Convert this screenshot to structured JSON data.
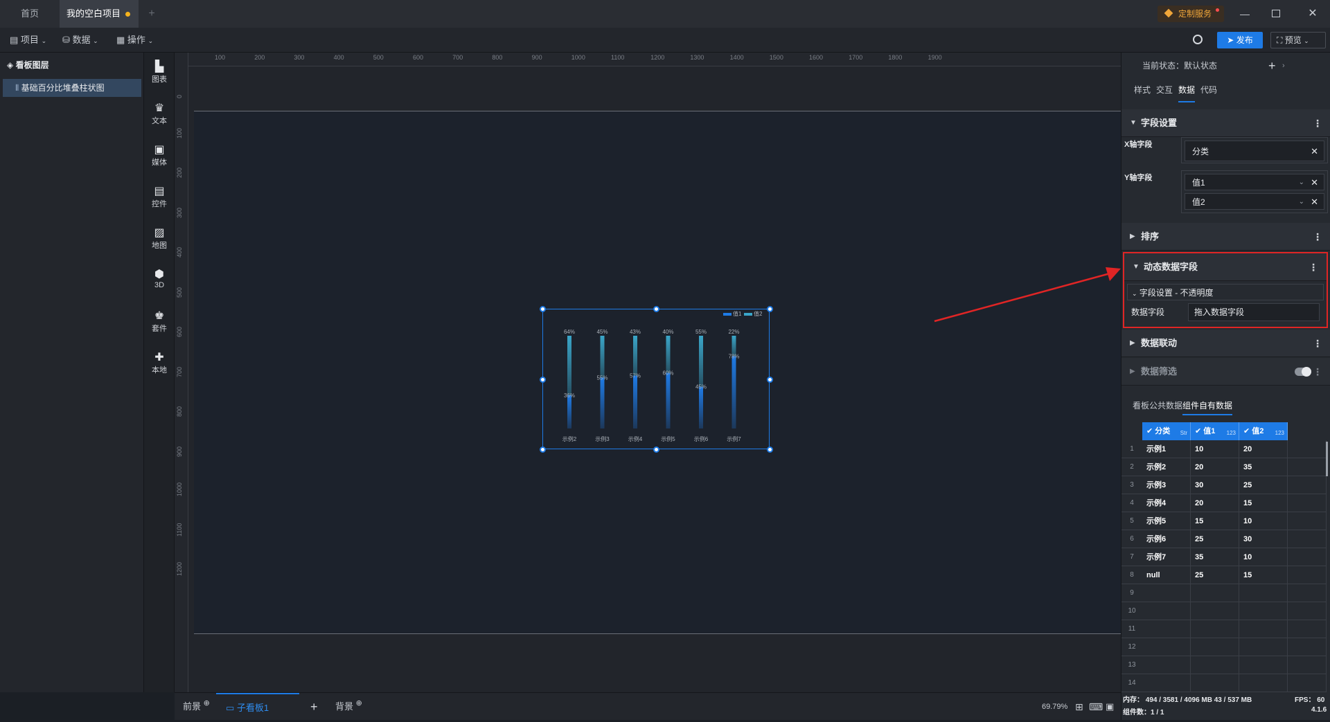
{
  "titlebar": {
    "tabs": [
      {
        "label": "首页",
        "active": false
      },
      {
        "label": "我的空白项目",
        "active": true,
        "modified": true
      }
    ],
    "add_tab": "+",
    "custom_service": "定制服务",
    "window_controls": [
      "minimize-icon",
      "restore-icon",
      "close-icon"
    ]
  },
  "toolbar": {
    "menus": [
      {
        "label": "项目",
        "icon": "file-icon"
      },
      {
        "label": "数据",
        "icon": "database-icon"
      },
      {
        "label": "操作",
        "icon": "grid-icon"
      }
    ],
    "publish": "发布",
    "preview": "预览"
  },
  "layers": {
    "title": "看板图层",
    "items": [
      {
        "label": "基础百分比堆叠柱状图",
        "selected": true
      }
    ]
  },
  "iconbar": {
    "items": [
      {
        "label": "图表",
        "icon": "chart-icon"
      },
      {
        "label": "文本",
        "icon": "text-icon"
      },
      {
        "label": "媒体",
        "icon": "media-icon"
      },
      {
        "label": "控件",
        "icon": "control-icon"
      },
      {
        "label": "地图",
        "icon": "map-icon"
      },
      {
        "label": "3D",
        "icon": "cube-icon"
      },
      {
        "label": "套件",
        "icon": "shirt-icon"
      },
      {
        "label": "本地",
        "icon": "puzzle-icon"
      }
    ]
  },
  "ruler": {
    "h_labels": [
      "100",
      "200",
      "300",
      "400",
      "500",
      "600",
      "700",
      "800",
      "900",
      "1000",
      "1100",
      "1200",
      "1300",
      "1400",
      "1500",
      "1600",
      "1700",
      "1800",
      "1900"
    ],
    "v_labels": [
      "0",
      "100",
      "200",
      "300",
      "400",
      "500",
      "600",
      "700",
      "800",
      "900",
      "1000",
      "1100",
      "1200"
    ]
  },
  "chart_data": {
    "type": "bar",
    "categories": [
      "示例2",
      "示例3",
      "示例4",
      "示例5",
      "示例6",
      "示例7"
    ],
    "series": [
      {
        "name": "值1",
        "values": [
          36,
          55,
          57,
          60,
          45,
          78
        ]
      },
      {
        "name": "值2",
        "values": [
          64,
          45,
          43,
          40,
          55,
          22
        ]
      }
    ],
    "stacked_percent": true,
    "legend": "top-right",
    "colors": {
      "s1": "#1e7be6",
      "s2": "#3aa6c9"
    }
  },
  "bottombar": {
    "tabs": [
      {
        "label": "前景",
        "active": false
      },
      {
        "label": "子看板1",
        "active": true
      },
      {
        "label": "背景",
        "active": false
      }
    ],
    "zoom": "69.79%"
  },
  "rpanel": {
    "state_label": "当前状态：默认状态",
    "tabs": [
      "样式",
      "交互",
      "数据",
      "代码"
    ],
    "active_tab": "数据",
    "field_settings": {
      "title": "字段设置",
      "x_label": "X轴字段",
      "x_value": "分类",
      "y_label": "Y轴字段",
      "y_values": [
        "值1",
        "值2"
      ]
    },
    "sort": "排序",
    "dynamic": {
      "title": "动态数据字段",
      "sub": "字段设置 - 不透明度",
      "field_label": "数据字段",
      "field_placeholder": "拖入数据字段"
    },
    "linkage": "数据联动",
    "filter": "数据筛选",
    "data_tabs": [
      "看板公共数据",
      "组件自有数据"
    ],
    "active_data_tab": "组件自有数据",
    "table": {
      "headers": [
        {
          "label": "分类",
          "type": "Str"
        },
        {
          "label": "值1",
          "type": "123"
        },
        {
          "label": "值2",
          "type": "123"
        }
      ],
      "rows": [
        [
          "示例1",
          "10",
          "20"
        ],
        [
          "示例2",
          "20",
          "35"
        ],
        [
          "示例3",
          "30",
          "25"
        ],
        [
          "示例4",
          "20",
          "15"
        ],
        [
          "示例5",
          "15",
          "10"
        ],
        [
          "示例6",
          "25",
          "30"
        ],
        [
          "示例7",
          "35",
          "10"
        ],
        [
          "null",
          "25",
          "15"
        ],
        [
          "",
          "",
          ""
        ],
        [
          "",
          "",
          ""
        ],
        [
          "",
          "",
          ""
        ],
        [
          "",
          "",
          ""
        ],
        [
          "",
          "",
          ""
        ],
        [
          "",
          "",
          ""
        ]
      ]
    }
  },
  "status": {
    "memory": "内存：  494 / 3581 / 4096 MB  43 / 537 MB",
    "fps": "FPS：  60",
    "components": "组件数：1 / 1",
    "version": "4.1.6"
  }
}
